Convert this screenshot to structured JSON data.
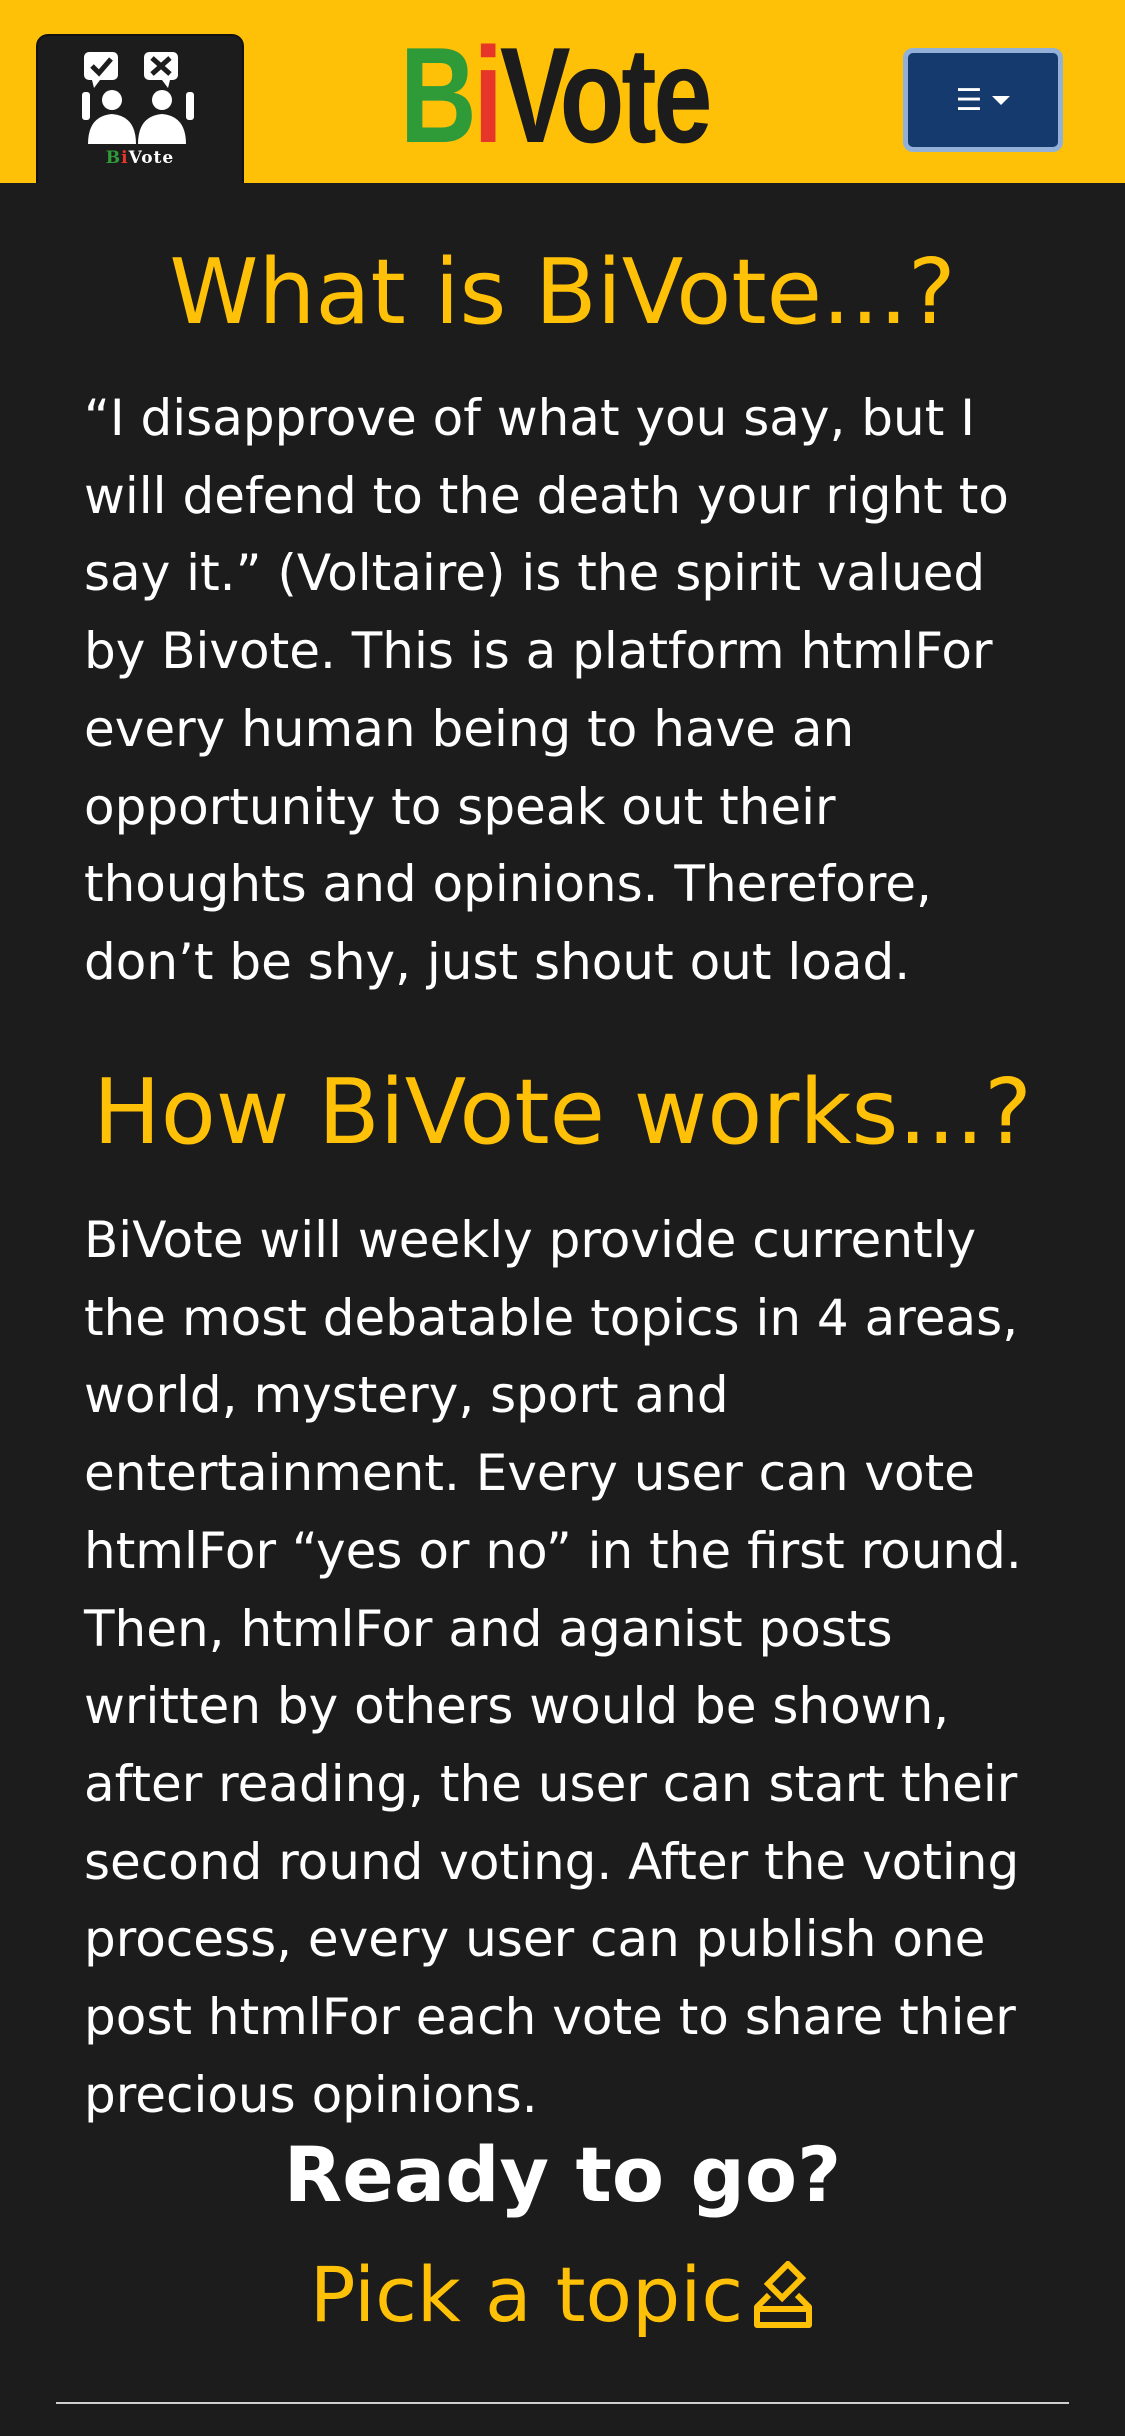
{
  "header": {
    "logo_text": "BiVote",
    "brand": {
      "part1": "B",
      "part2": "i",
      "part3": "Vote"
    },
    "menu_icon": "hamburger-icon",
    "colors": {
      "background": "#ffc107",
      "brand_green": "#2e9a38",
      "brand_red": "#e53629",
      "menu_button": "#153a6e"
    }
  },
  "about": {
    "title": "What is BiVote...?",
    "body": "“I disapprove of what you say, but I will defend to the death your right to say it.” (Voltaire) is the spirit valued by Bivote. This is a platform htmlFor every human being to have an opportunity to speak out their thoughts and opinions. Therefore, don’t be shy, just shout out load."
  },
  "how": {
    "title": "How BiVote works...?",
    "body": "BiVote will weekly provide currently the most debatable topics in 4 areas, world, mystery, sport and entertainment. Every user can vote htmlFor “yes or no” in the first round. Then, htmlFor and aganist posts written by others would be shown, after reading, the user can start their second round voting. After the voting process, every user can publish one post htmlFor each vote to share thier precious opinions."
  },
  "cta": {
    "heading": "Ready to go?",
    "link_label": "Pick a topic",
    "link_icon": "ballot-box-icon"
  },
  "theme": {
    "accent": "#ffc107",
    "page_background": "#1c1c1c",
    "text": "#ffffff"
  }
}
